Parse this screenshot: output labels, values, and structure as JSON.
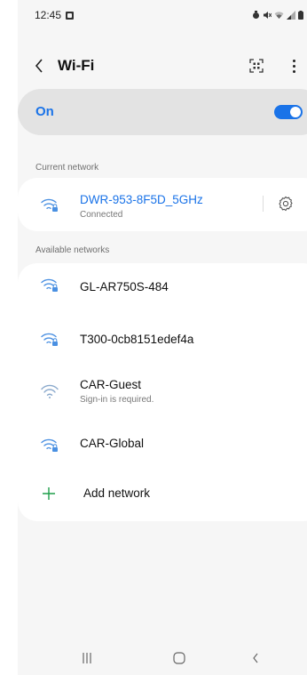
{
  "status_bar": {
    "time": "12:45",
    "icons": [
      "image-notification-icon",
      "alarm-icon",
      "mute-icon",
      "wifi-status-icon",
      "signal-icon",
      "battery-icon"
    ]
  },
  "app_bar": {
    "title": "Wi-Fi",
    "icons": [
      "back-icon",
      "qr-scan-icon",
      "more-options-icon"
    ]
  },
  "wifi_toggle": {
    "label": "On",
    "enabled": true
  },
  "current_network": {
    "section_label": "Current network",
    "name": "DWR-953-8F5D_5GHz",
    "status": "Connected",
    "secured": true
  },
  "available_networks": {
    "section_label": "Available networks",
    "items": [
      {
        "name": "GL-AR750S-484",
        "secured": true
      },
      {
        "name": "T300-0cb8151edef4a",
        "secured": true
      },
      {
        "name": "CAR-Guest",
        "sub": "Sign-in is required.",
        "secured": false
      },
      {
        "name": "CAR-Global",
        "secured": true
      }
    ],
    "add_label": "Add network"
  },
  "colors": {
    "accent": "#1a73e8",
    "background": "#f6f6f6",
    "card": "#ffffff",
    "toggle_bar": "#e3e3e3",
    "wifi_icon": "#4a90e2"
  },
  "nav_bar": {
    "icons": [
      "recent-apps-icon",
      "home-icon",
      "back-nav-icon"
    ]
  }
}
